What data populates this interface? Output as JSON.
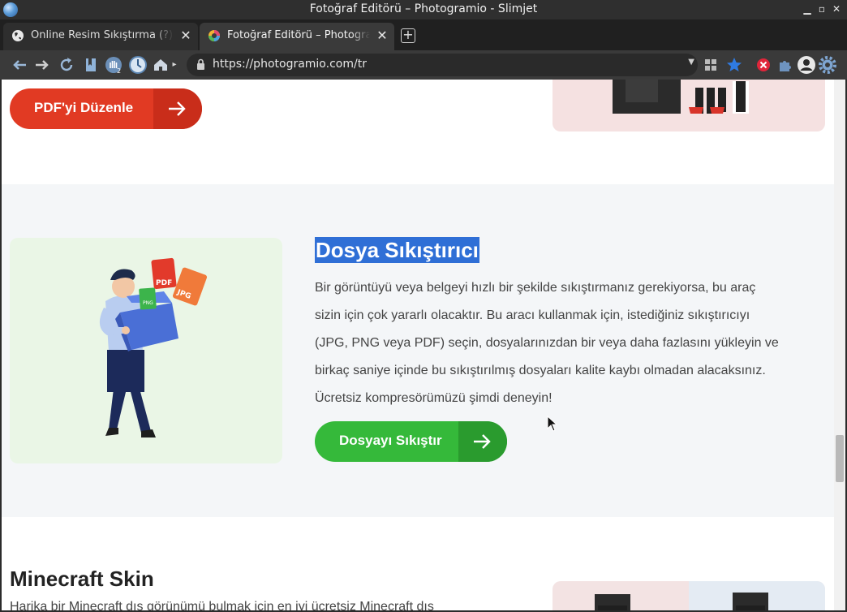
{
  "window": {
    "title": "Fotoğraf Editörü – Photogramio - Slimjet"
  },
  "tabs": [
    {
      "label": "Online Resim Sıkıştırma (?) | Tü",
      "active": false
    },
    {
      "label": "Fotoğraf Editörü – Photogramio",
      "active": true
    }
  ],
  "toolbar": {
    "url": "https://photogramio.com/tr"
  },
  "page": {
    "top_button": "PDF'yi Düzenle",
    "section": {
      "heading": "Dosya Sıkıştırıcı",
      "lines": [
        "Bir görüntüyü veya belgeyi hızlı bir şekilde sıkıştırmanız gerekiyorsa, bu araç",
        "sizin için çok yararlı olacaktır. Bu aracı kullanmak için, istediğiniz sıkıştırıcıyı",
        "(JPG, PNG veya PDF) seçin, dosyalarınızdan bir veya daha fazlasını yükleyin ve",
        "birkaç saniye içinde bu sıkıştırılmış dosyaları kalite kaybı olmadan alacaksınız.",
        "Ücretsiz kompresörümüzü şimdi deneyin!"
      ],
      "button": "Dosyayı Sıkıştır",
      "file_badges": [
        "PDF",
        "JPG",
        "PNG"
      ]
    },
    "minecraft": {
      "heading": "Minecraft Skin",
      "text": "Harika bir Minecraft dış görünümü bulmak için en iyi ücretsiz Minecraft dış"
    }
  },
  "colors": {
    "red_button": "#e13a23",
    "green_button": "#35b93a",
    "highlight": "#2f6fd6"
  }
}
